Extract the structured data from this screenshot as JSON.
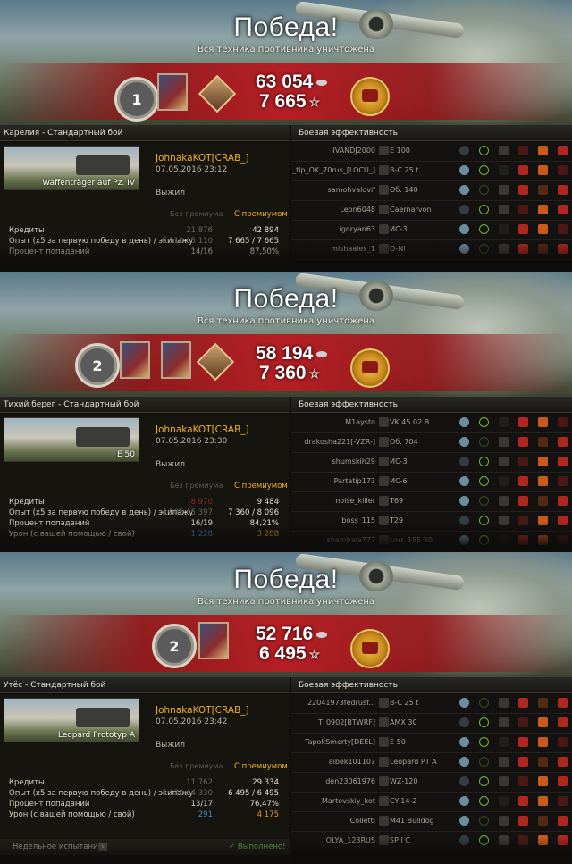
{
  "panels": [
    {
      "title": "Победа!",
      "subtitle": "Вся техника противника уничтожена",
      "rank": "1",
      "credits": "63 054",
      "xp": "7 665",
      "map": "Карелия - Стандартный бой",
      "eff_header": "Боевая эффективность",
      "tank": "Waffenträger auf Pz. IV",
      "player": "JohnakaKOT[CRAB_]",
      "date": "07.05.2016 23:12",
      "status": "Выжил",
      "col_nopremium": "Без премиума",
      "col_premium": "С премиумом",
      "rows": [
        {
          "label": "Кредиты",
          "v1": "21 876",
          "v2": "42 894",
          "v1_style": "",
          "v2_style": ""
        },
        {
          "label": "Опыт  (х5 за первую победу в день) / экипажу",
          "v1": "5 110 / 5 110",
          "v2": "7 665 / 7 665",
          "v1_style": "",
          "v2_style": ""
        },
        {
          "label": "Процент попаданий",
          "v1": "14/16",
          "v2": "87,50%",
          "v1_style": "bright",
          "v2_style": ""
        }
      ],
      "players": [
        {
          "name": "IVANDJ2000",
          "tank": "E 100"
        },
        {
          "name": "_tip_OK_70rus_[LOCU_]",
          "tank": "B-C 25 t"
        },
        {
          "name": "samohvalovif",
          "tank": "Об. 140"
        },
        {
          "name": "Leon6048",
          "tank": "Caernarvon"
        },
        {
          "name": "igoryan63",
          "tank": "ИС-3"
        },
        {
          "name": "mishaalex_1",
          "tank": "O-Ni"
        }
      ],
      "weekly": null
    },
    {
      "title": "Победа!",
      "subtitle": "Вся техника противника уничтожена",
      "rank": "2",
      "credits": "58 194",
      "xp": "7 360",
      "map": "Тихий берег - Стандартный бой",
      "eff_header": "Боевая эффективность",
      "tank": "E 50",
      "player": "JohnakaKOT[CRAB_]",
      "date": "07.05.2016 23:30",
      "status": "Выжил",
      "col_nopremium": "Без премиума",
      "col_premium": "С премиумом",
      "rows": [
        {
          "label": "Кредиты",
          "v1": "-8 970",
          "v2": "9 484",
          "v1_style": "red",
          "v2_style": ""
        },
        {
          "label": "Опыт  (х5 за первую победу в день) / экипажу",
          "v1": "4 905 / 5 397",
          "v2": "7 360 / 8 096",
          "v1_style": "",
          "v2_style": ""
        },
        {
          "label": "Процент попаданий",
          "v1": "16/19",
          "v2": "84,21%",
          "v1_style": "bright",
          "v2_style": ""
        },
        {
          "label": "Урон (с вашей помощью / свой)",
          "v1": "1 228",
          "v2": "3 288",
          "v1_style": "blue",
          "v2_style": "orange"
        }
      ],
      "players": [
        {
          "name": "M1aysto",
          "tank": "VK 45.02 B"
        },
        {
          "name": "drakosha221[-VZR-]",
          "tank": "Об. 704"
        },
        {
          "name": "shumskih29",
          "tank": "ИС-3"
        },
        {
          "name": "Partatip173",
          "tank": "ИС-6"
        },
        {
          "name": "noise_killer",
          "tank": "T69"
        },
        {
          "name": "boss_115",
          "tank": "T29"
        },
        {
          "name": "shambala777",
          "tank": "Lorr. 155 50"
        }
      ],
      "weekly": null
    },
    {
      "title": "Победа!",
      "subtitle": "Вся техника противника уничтожена",
      "rank": "2",
      "credits": "52 716",
      "xp": "6 495",
      "map": "Утёс - Стандартный бой",
      "eff_header": "Боевая эффективность",
      "tank": "Leopard Prototyp A",
      "player": "JohnakaKOT[CRAB_]",
      "date": "07.05.2016 23:42",
      "status": "Выжил",
      "col_nopremium": "Без премиума",
      "col_premium": "С премиумом",
      "rows": [
        {
          "label": "Кредиты",
          "v1": "11 762",
          "v2": "29 334",
          "v1_style": "",
          "v2_style": ""
        },
        {
          "label": "Опыт  (х5 за первую победу в день) / экипажу",
          "v1": "4 330 / 4 330",
          "v2": "6 495 / 6 495",
          "v1_style": "",
          "v2_style": ""
        },
        {
          "label": "Процент попаданий",
          "v1": "13/17",
          "v2": "76,47%",
          "v1_style": "bright",
          "v2_style": ""
        },
        {
          "label": "Урон (с вашей помощью / свой)",
          "v1": "291",
          "v2": "4 175",
          "v1_style": "blue",
          "v2_style": "orange"
        }
      ],
      "players": [
        {
          "name": "22041973fedrusf...",
          "tank": "B-C 25 t"
        },
        {
          "name": "T_0902[BTWRF]",
          "tank": "AMX 30"
        },
        {
          "name": "TapokSmerty[DEEL]",
          "tank": "E 50"
        },
        {
          "name": "aibek101107",
          "tank": "Leopard PT A"
        },
        {
          "name": "den23061976",
          "tank": "WZ-120"
        },
        {
          "name": "Martovskiy_kot",
          "tank": "CY-14-2"
        },
        {
          "name": "Colletti",
          "tank": "M41 Bulldog"
        },
        {
          "name": "OLYA_123RUS",
          "tank": "SP I C"
        }
      ],
      "weekly": {
        "label": "Недельное испытание",
        "done": "✓ Выполнено!"
      }
    }
  ]
}
